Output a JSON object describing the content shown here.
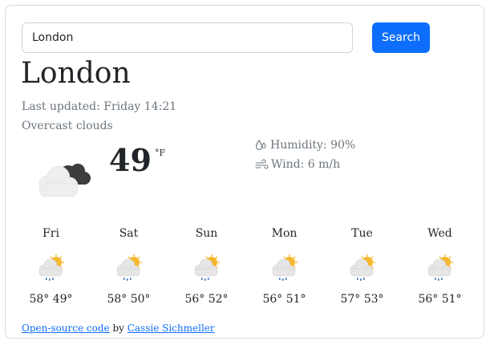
{
  "search": {
    "value": "London",
    "button_label": "Search"
  },
  "current": {
    "city": "London",
    "last_updated": "Last updated: Friday 14:21",
    "description": "Overcast clouds",
    "icon": "overcast-clouds-icon",
    "temperature": "49",
    "unit": "°F",
    "humidity": "Humidity: 90%",
    "wind": "Wind: 6 m/h"
  },
  "forecast": [
    {
      "day": "Fri",
      "temps": "58° 49°",
      "icon": "cloud-sun-rain-icon"
    },
    {
      "day": "Sat",
      "temps": "58° 50°",
      "icon": "cloud-sun-rain-icon"
    },
    {
      "day": "Sun",
      "temps": "56° 52°",
      "icon": "cloud-sun-rain-icon"
    },
    {
      "day": "Mon",
      "temps": "56° 51°",
      "icon": "cloud-sun-rain-icon"
    },
    {
      "day": "Tue",
      "temps": "57° 53°",
      "icon": "cloud-sun-rain-icon"
    },
    {
      "day": "Wed",
      "temps": "56° 51°",
      "icon": "cloud-sun-rain-icon"
    }
  ],
  "footer": {
    "link_text": "Open-source code",
    "by_text": " by ",
    "author": "Cassie Sichmeller"
  },
  "colors": {
    "accent": "#0d6efd",
    "muted_text": "#6c757d",
    "sun": "#f5b82e"
  }
}
